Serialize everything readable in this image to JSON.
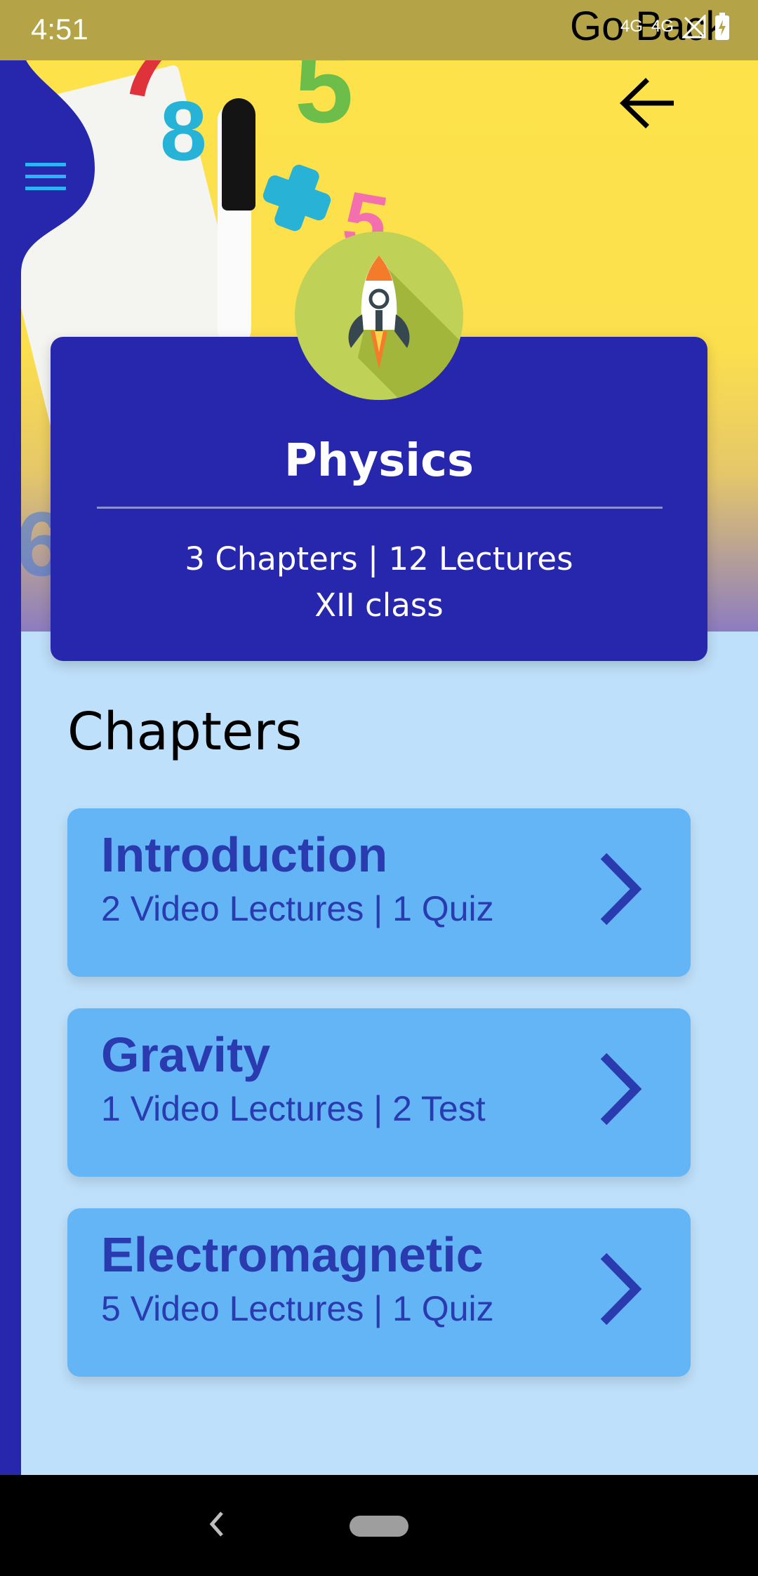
{
  "status_bar": {
    "time": "4:51",
    "overlay_text": "Go Back",
    "signal_a": "4G",
    "signal_b": "4G"
  },
  "header": {
    "back_icon": "arrow-left-icon",
    "menu_icon": "hamburger-menu-icon"
  },
  "subject": {
    "title": "Physics",
    "stats": "3 Chapters | 12 Lectures",
    "class_label": "XII class",
    "icon": "rocket-icon"
  },
  "chapters_section": {
    "title": "Chapters",
    "items": [
      {
        "name": "Introduction",
        "meta": "2 Video Lectures | 1 Quiz"
      },
      {
        "name": "Gravity",
        "meta": "1 Video Lectures | 2 Test"
      },
      {
        "name": "Electromagnetic",
        "meta": "5 Video Lectures | 1 Quiz"
      }
    ]
  },
  "colors": {
    "primary": "#2727ae",
    "card": "#64b5f6",
    "card_text": "#2a3bb0",
    "background": "#bfe0fa",
    "accent_icon_bg": "#c0d158"
  }
}
